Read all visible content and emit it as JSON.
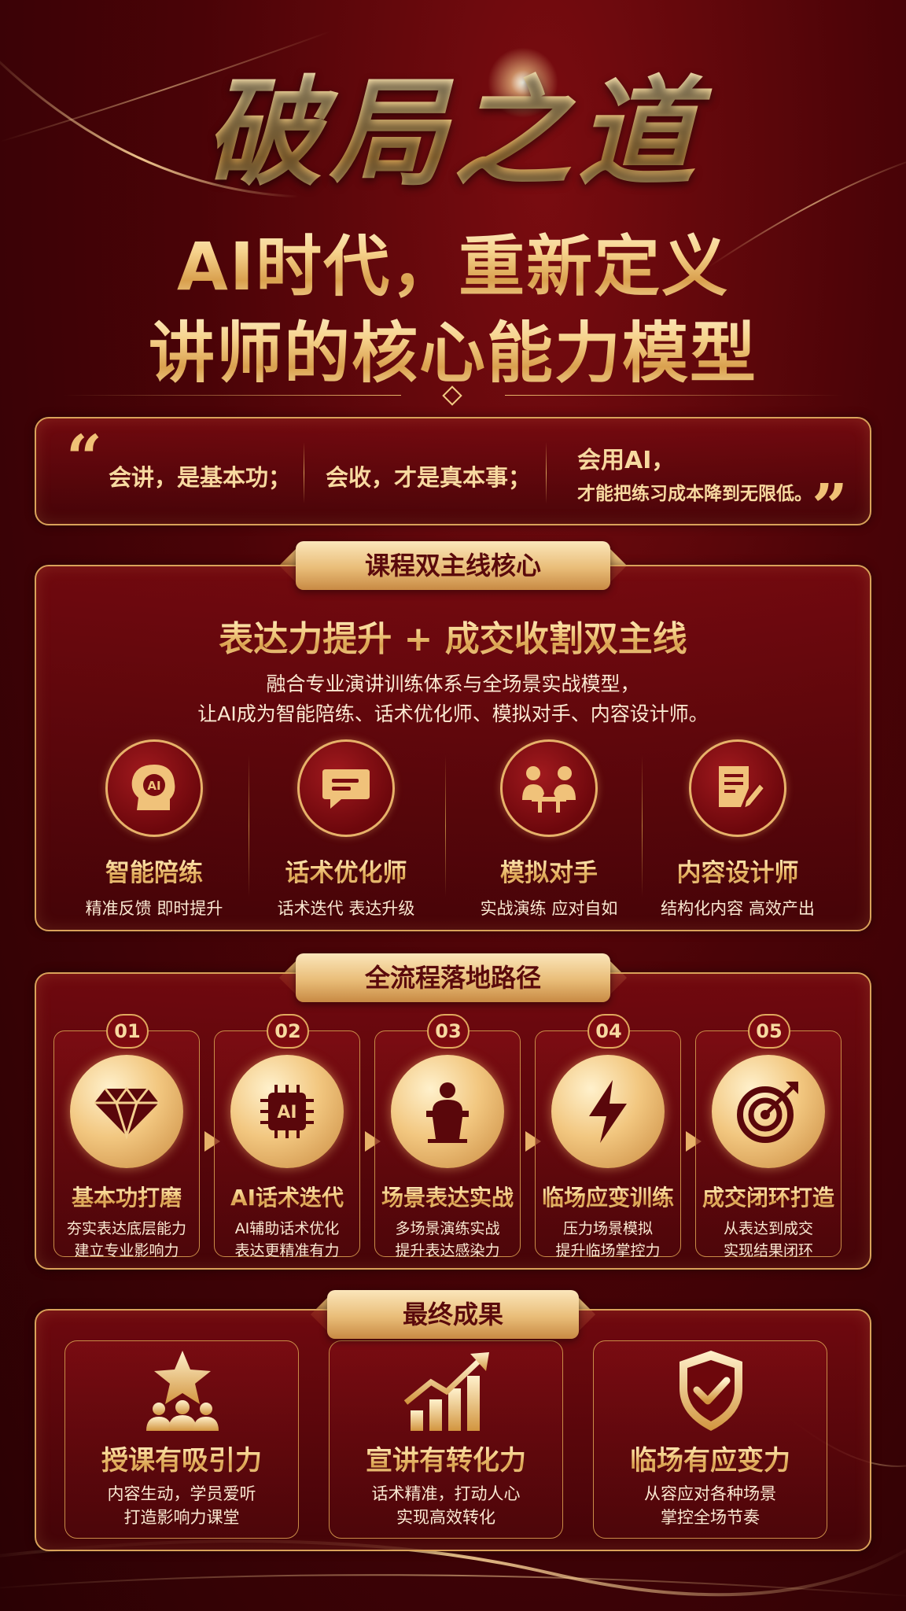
{
  "header": {
    "title": "破局之道",
    "subtitle_line1": "AI时代，重新定义",
    "subtitle_line2": "讲师的核心能力模型"
  },
  "quote": {
    "part1": "会讲，是基本功；",
    "part2": "会收，才是真本事；",
    "part3_line1": "会用AI，",
    "part3_line2": "才能把练习成本降到无限低。"
  },
  "core": {
    "tag": "课程双主线核心",
    "heading": "表达力提升 + 成交收割双主线",
    "desc_line1": "融合专业演讲训练体系与全场景实战模型，",
    "desc_line2": "让AI成为智能陪练、话术优化师、模拟对手、内容设计师。",
    "features": [
      {
        "icon": "ai-head-icon",
        "title": "智能陪练",
        "sub": "精准反馈 即时提升"
      },
      {
        "icon": "chat-bubble-icon",
        "title": "话术优化师",
        "sub": "话术迭代 表达升级"
      },
      {
        "icon": "opponents-icon",
        "title": "模拟对手",
        "sub": "实战演练 应对自如"
      },
      {
        "icon": "edit-document-icon",
        "title": "内容设计师",
        "sub": "结构化内容 高效产出"
      }
    ]
  },
  "path": {
    "tag": "全流程落地路径",
    "steps": [
      {
        "num": "01",
        "icon": "diamond-icon",
        "title": "基本功打磨",
        "d1": "夯实表达底层能力",
        "d2": "建立专业影响力"
      },
      {
        "num": "02",
        "icon": "ai-chip-icon",
        "title": "AI话术迭代",
        "d1": "AI辅助话术优化",
        "d2": "表达更精准有力"
      },
      {
        "num": "03",
        "icon": "speaker-podium-icon",
        "title": "场景表达实战",
        "d1": "多场景演练实战",
        "d2": "提升表达感染力"
      },
      {
        "num": "04",
        "icon": "lightning-icon",
        "title": "临场应变训练",
        "d1": "压力场景模拟",
        "d2": "提升临场掌控力"
      },
      {
        "num": "05",
        "icon": "target-icon",
        "title": "成交闭环打造",
        "d1": "从表达到成交",
        "d2": "实现结果闭环"
      }
    ]
  },
  "results": {
    "tag": "最终成果",
    "items": [
      {
        "icon": "star-audience-icon",
        "title": "授课有吸引力",
        "d1": "内容生动，学员爱听",
        "d2": "打造影响力课堂"
      },
      {
        "icon": "growth-chart-icon",
        "title": "宣讲有转化力",
        "d1": "话术精准，打动人心",
        "d2": "实现高效转化"
      },
      {
        "icon": "shield-check-icon",
        "title": "临场有应变力",
        "d1": "从容应对各种场景",
        "d2": "掌控全场节奏"
      }
    ]
  },
  "colors": {
    "accent_gold": "#e7b26a",
    "background_red": "#4a0307"
  }
}
